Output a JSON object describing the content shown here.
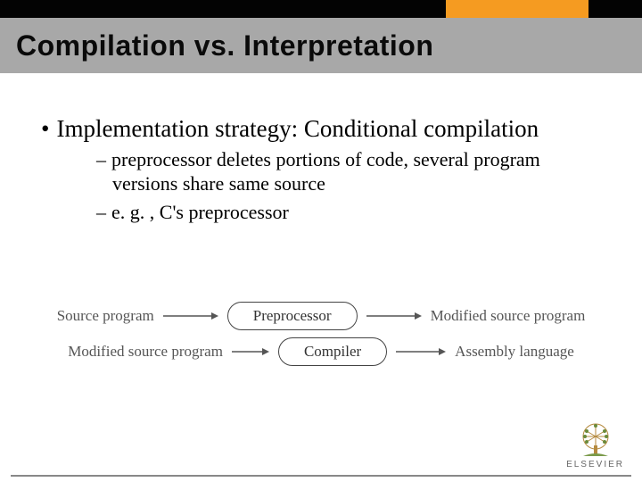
{
  "slide": {
    "title": "Compilation vs. Interpretation",
    "bullet": {
      "lead": "Implementation strategy: ",
      "topic": "Conditional compilation"
    },
    "sub1": "preprocessor deletes portions of code, several program versions share same source",
    "sub2": "e. g. , C's preprocessor",
    "diagram": {
      "row1": {
        "in": "Source program",
        "box": "Preprocessor",
        "out": "Modified source program"
      },
      "row2": {
        "in": "Modified source program",
        "box": "Compiler",
        "out": "Assembly language"
      }
    },
    "publisher": "ELSEVIER"
  }
}
